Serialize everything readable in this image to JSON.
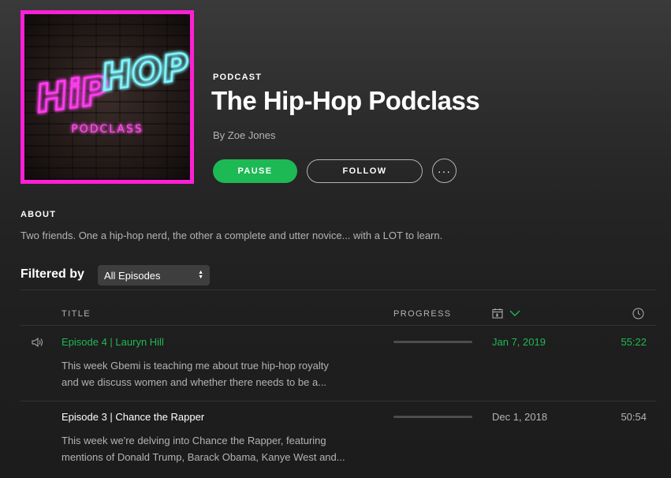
{
  "podcast": {
    "cover_text_line1": "HiP HOP",
    "cover_text_line2": "PODCLASS",
    "type_label": "PODCAST",
    "title": "The Hip-Hop Podclass",
    "author": "By Zoe Jones"
  },
  "actions": {
    "pause_label": "PAUSE",
    "follow_label": "FOLLOW",
    "more_label": "···"
  },
  "about": {
    "heading": "ABOUT",
    "text": "Two friends. One a hip-hop nerd, the other a complete and utter novice... with a LOT to learn."
  },
  "filter": {
    "label": "Filtered by",
    "selected": "All Episodes"
  },
  "table": {
    "columns": {
      "title": "TITLE",
      "progress": "PROGRESS"
    },
    "sort_icon": "calendar-icon",
    "sort_direction": "descending",
    "duration_icon": "clock-icon"
  },
  "episodes": [
    {
      "title": "Episode 4 | Lauryn Hill",
      "description_line1": "This week Gbemi is teaching me about true hip-hop royalty",
      "description_line2": "and we discuss women and whether there needs to be a...",
      "date": "Jan 7, 2019",
      "duration": "55:22",
      "progress": 0,
      "playing": true
    },
    {
      "title": "Episode 3 | Chance the Rapper",
      "description_line1": "This week we're delving into Chance the Rapper, featuring",
      "description_line2": "mentions of Donald Trump, Barack Obama, Kanye West and...",
      "date": "Dec 1, 2018",
      "duration": "50:54",
      "progress": 0,
      "playing": false
    }
  ],
  "colors": {
    "accent": "#1db954",
    "cover_border": "#ff1fd6",
    "neon_pink": "#ff3df0",
    "neon_cyan": "#7ff6ff"
  }
}
